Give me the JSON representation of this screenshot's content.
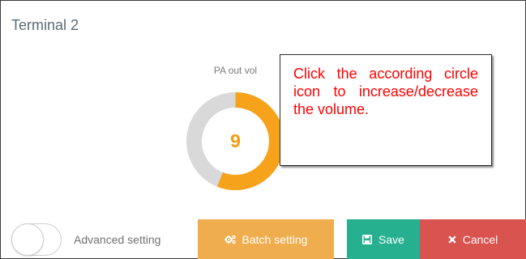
{
  "panel": {
    "title": "Terminal 2"
  },
  "volume": {
    "label": "PA out vol",
    "value": "9",
    "level_fraction": 0.56,
    "fill_color": "#f7a21b",
    "track_color": "#d9d9d9"
  },
  "tooltip": {
    "text": "Click the according circle icon to increase/decrease the volume.",
    "color": "#ff0000"
  },
  "advanced": {
    "label": "Advanced setting",
    "enabled": false
  },
  "buttons": {
    "batch": {
      "label": "Batch setting",
      "icon": "gears-icon",
      "color": "#f0ad4e"
    },
    "save": {
      "label": "Save",
      "icon": "floppy-disk-icon",
      "color": "#26b08f"
    },
    "cancel": {
      "label": "Cancel",
      "icon": "close-icon",
      "color": "#d9534f"
    }
  }
}
